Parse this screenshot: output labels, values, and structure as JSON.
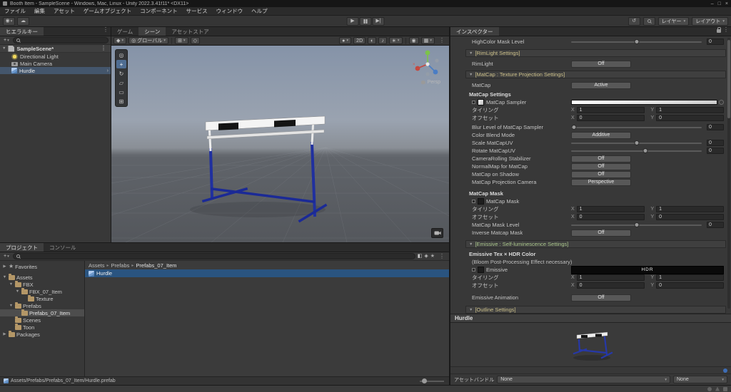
{
  "window": {
    "title": "Booth Item - SampleScene - Windows, Mac, Linux - Unity 2022.3.41f11* <DX11>"
  },
  "menu_bar": {
    "items": [
      "ファイル",
      "編集",
      "アセット",
      "ゲームオブジェクト",
      "コンポーネント",
      "サービス",
      "ウィンドウ",
      "ヘルプ"
    ]
  },
  "toolbar": {
    "layers_label": "レイヤー",
    "layout_label": "レイアウト"
  },
  "hierarchy": {
    "tab": "ヒエラルキー",
    "scene_name": "SampleScene*",
    "items": [
      {
        "label": "Directional Light",
        "icon": "light",
        "selected": false
      },
      {
        "label": "Main Camera",
        "icon": "camera",
        "selected": false
      },
      {
        "label": "Hurdle",
        "icon": "prefab",
        "selected": true,
        "chevron": true
      }
    ]
  },
  "scene": {
    "tabs": [
      {
        "label": "ゲーム",
        "active": false
      },
      {
        "label": "シーン",
        "active": true
      },
      {
        "label": "アセットストア",
        "active": false
      }
    ],
    "toolbar": {
      "global_label": "グローバル",
      "two_d_label": "2D"
    },
    "persp_label": "Persp"
  },
  "inspector": {
    "tab": "インスペクター",
    "rows": [
      {
        "type": "slider",
        "label": "HighColor Mask Level",
        "value": "0",
        "pos": 0.5
      },
      {
        "type": "section",
        "label": "[RimLight Settings]",
        "color": "#CCC08A",
        "mt": 5
      },
      {
        "type": "button",
        "label": "RimLight",
        "button": "Off",
        "mt": 4
      },
      {
        "type": "section",
        "label": "[MatCap : Texture Projection Settings]",
        "color": "#CCC08A",
        "mt": 4
      },
      {
        "type": "button",
        "label": "MatCap",
        "button": "Active",
        "mt": 4
      },
      {
        "type": "bold",
        "label": "MatCap Settings",
        "mt": 2
      },
      {
        "type": "texture",
        "label": "MatCap Sampler",
        "thumb": "light",
        "strip": true
      },
      {
        "type": "xy",
        "label": "タイリング",
        "x": "1",
        "y": "1"
      },
      {
        "type": "xy",
        "label": "オフセット",
        "x": "0",
        "y": "0"
      },
      {
        "type": "slider",
        "label": "Blur Level of MatCap Sampler",
        "value": "0",
        "pos": 0.02,
        "mt": 2
      },
      {
        "type": "button",
        "label": "Color Blend Mode",
        "button": "Additive"
      },
      {
        "type": "slider",
        "label": "Scale MatCapUV",
        "value": "0",
        "pos": 0.5
      },
      {
        "type": "slider",
        "label": "Rotate MatCapUV",
        "value": "0",
        "pos": 0.57
      },
      {
        "type": "button",
        "label": "CameraRolling Stabilizer",
        "button": "Off"
      },
      {
        "type": "button",
        "label": "NormalMap for MatCap",
        "button": "Off"
      },
      {
        "type": "button",
        "label": "MatCap on Shadow",
        "button": "Off"
      },
      {
        "type": "button",
        "label": "MatCap Projection Camera",
        "button": "Perspective"
      },
      {
        "type": "bold",
        "label": "MatCap Mask",
        "mt": 5
      },
      {
        "type": "texture",
        "label": "MatCap Mask",
        "thumb": "dark",
        "strip": false
      },
      {
        "type": "xy",
        "label": "タイリング",
        "x": "1",
        "y": "1"
      },
      {
        "type": "xy",
        "label": "オフセット",
        "x": "0",
        "y": "0"
      },
      {
        "type": "slider",
        "label": "MatCap Mask Level",
        "value": "0",
        "pos": 0.5
      },
      {
        "type": "button",
        "label": "Inverse Matcap Mask",
        "button": "Off"
      },
      {
        "type": "section",
        "label": "[Emissive : Self-luminescence Settings]",
        "color": "#A9C58B",
        "mt": 5
      },
      {
        "type": "bold",
        "label": "Emissive Tex × HDR Color",
        "mt": 3
      },
      {
        "type": "plain",
        "label": "(Bloom Post-Processing Effect necessary)"
      },
      {
        "type": "hdr",
        "label": "Emissive",
        "thumb": "dark",
        "hdr_label": "HDR"
      },
      {
        "type": "xy",
        "label": "タイリング",
        "x": "1",
        "y": "1"
      },
      {
        "type": "xy",
        "label": "オフセット",
        "x": "0",
        "y": "0"
      },
      {
        "type": "button",
        "label": "Emissive Animation",
        "button": "Off",
        "mt": 6
      },
      {
        "type": "section",
        "label": "[Outline Settings]",
        "color": "#CCC08A",
        "mt": 6
      }
    ],
    "footer": {
      "title": "Hurdle",
      "assetbundle_label": "アセットバンドル",
      "bundle_value": "None",
      "variant_value": "None"
    }
  },
  "project": {
    "tabs": [
      {
        "label": "プロジェクト",
        "active": true
      },
      {
        "label": "コンソール",
        "active": false
      }
    ],
    "tree": [
      {
        "label": "Favorites",
        "depth": 0,
        "arrow": "▶",
        "icon": "star"
      },
      {
        "label": "Assets",
        "depth": 0,
        "arrow": "▼",
        "icon": "folder",
        "gap_before": true
      },
      {
        "label": "FBX",
        "depth": 1,
        "arrow": "▼",
        "icon": "folder"
      },
      {
        "label": "FBX_07_Item",
        "depth": 2,
        "arrow": "▼",
        "icon": "folder"
      },
      {
        "label": "Texture",
        "depth": 3,
        "arrow": "",
        "icon": "folder"
      },
      {
        "label": "Prefabs",
        "depth": 1,
        "arrow": "▼",
        "icon": "folder"
      },
      {
        "label": "Prefabs_07_Item",
        "depth": 2,
        "arrow": "",
        "icon": "folder",
        "selected": true
      },
      {
        "label": "Scenes",
        "depth": 1,
        "arrow": "",
        "icon": "folder"
      },
      {
        "label": "Toon",
        "depth": 1,
        "arrow": "",
        "icon": "folder"
      },
      {
        "label": "Packages",
        "depth": 0,
        "arrow": "▶",
        "icon": "folder"
      }
    ],
    "breadcrumbs": [
      "Assets",
      "Prefabs",
      "Prefabs_07_Item"
    ],
    "items": [
      {
        "label": "Hurdle"
      }
    ],
    "path": "Assets/Prefabs/Prefabs_07_Item/Hurdle.prefab"
  }
}
